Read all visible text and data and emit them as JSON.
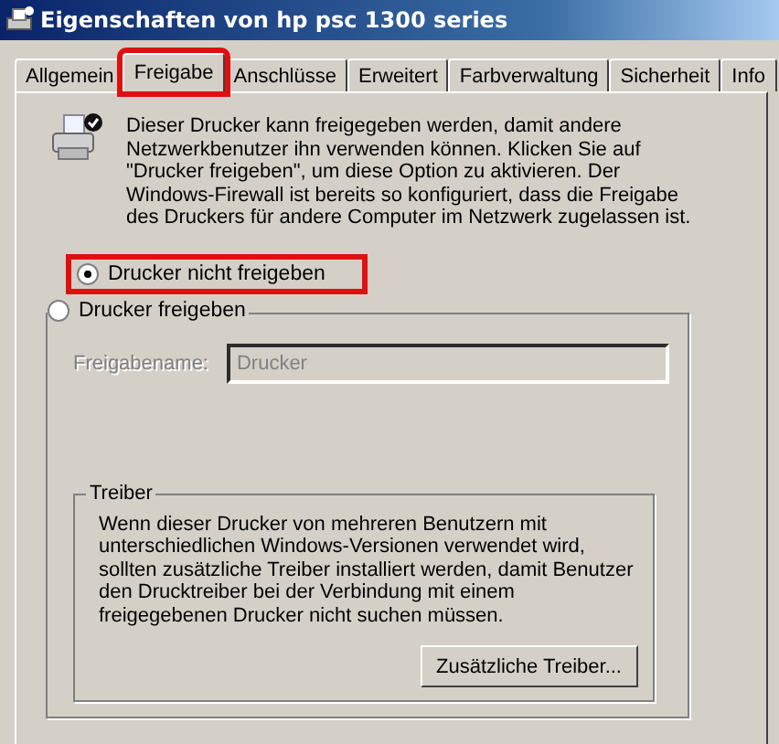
{
  "window": {
    "title": "Eigenschaften von hp psc 1300 series"
  },
  "tabs": [
    {
      "label": "Allgemein",
      "selected": false,
      "highlighted": false
    },
    {
      "label": "Freigabe",
      "selected": true,
      "highlighted": true
    },
    {
      "label": "Anschlüsse",
      "selected": false,
      "highlighted": false
    },
    {
      "label": "Erweitert",
      "selected": false,
      "highlighted": false
    },
    {
      "label": "Farbverwaltung",
      "selected": false,
      "highlighted": false
    },
    {
      "label": "Sicherheit",
      "selected": false,
      "highlighted": false
    },
    {
      "label": "Info",
      "selected": false,
      "highlighted": false
    }
  ],
  "intro": "Dieser Drucker kann freigegeben werden, damit andere Netzwerkbenutzer ihn verwenden können. Klicken Sie auf \"Drucker freigeben\", um diese Option zu aktivieren. Der Windows-Firewall ist bereits so konfiguriert, dass die Freigabe des Druckers für andere Computer im Netzwerk zugelassen ist.",
  "sharing_options": [
    {
      "label": "Drucker nicht freigeben",
      "selected": true,
      "highlighted": true
    },
    {
      "label": "Drucker freigeben",
      "selected": false,
      "highlighted": false
    }
  ],
  "share_name": {
    "label": "Freigabename:",
    "value": "Drucker",
    "disabled": true
  },
  "drivers": {
    "title": "Treiber",
    "text": "Wenn dieser Drucker von mehreren Benutzern mit unterschiedlichen Windows-Versionen verwendet wird, sollten zusätzliche Treiber installiert werden, damit Benutzer den Drucktreiber bei der Verbindung mit einem freigegebenen Drucker nicht suchen müssen.",
    "button": "Zusätzliche Treiber..."
  }
}
